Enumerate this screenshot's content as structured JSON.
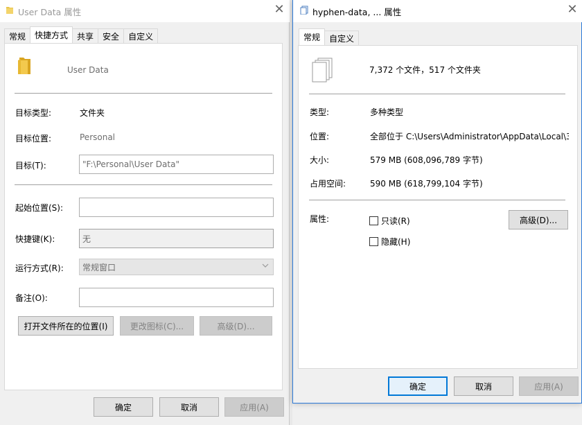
{
  "win1": {
    "title": "User Data 属性",
    "close": "✕",
    "tabs": [
      "常规",
      "快捷方式",
      "共享",
      "安全",
      "自定义"
    ],
    "name": "User Data",
    "fields": {
      "target_type_label": "目标类型:",
      "target_type_value": "文件夹",
      "target_location_label": "目标位置:",
      "target_location_value": "Personal",
      "target_label": "目标(T):",
      "target_value": "\"F:\\Personal\\User Data\"",
      "start_in_label": "起始位置(S):",
      "start_in_value": "",
      "shortcut_key_label": "快捷键(K):",
      "shortcut_key_value": "无",
      "run_label": "运行方式(R):",
      "run_value": "常规窗口",
      "comment_label": "备注(O):",
      "comment_value": ""
    },
    "buttons": {
      "open_location": "打开文件所在的位置(I)",
      "change_icon": "更改图标(C)...",
      "advanced": "高级(D)...",
      "ok": "确定",
      "cancel": "取消",
      "apply": "应用(A)"
    }
  },
  "win2": {
    "title": "hyphen-data, ... 属性",
    "close": "✕",
    "tabs": [
      "常规",
      "自定义"
    ],
    "summary": "7,372 个文件，517 个文件夹",
    "type_label": "类型:",
    "type_value": "多种类型",
    "location_label": "位置:",
    "location_value": "全部位于 C:\\Users\\Administrator\\AppData\\Local\\3",
    "size_label": "大小:",
    "size_value": "579 MB (608,096,789 字节)",
    "disk_label": "占用空间:",
    "disk_value": "590 MB (618,799,104 字节)",
    "attr_label": "属性:",
    "readonly": "只读(R)",
    "hidden": "隐藏(H)",
    "advanced": "高级(D)...",
    "ok": "确定",
    "cancel": "取消",
    "apply": "应用(A)"
  }
}
